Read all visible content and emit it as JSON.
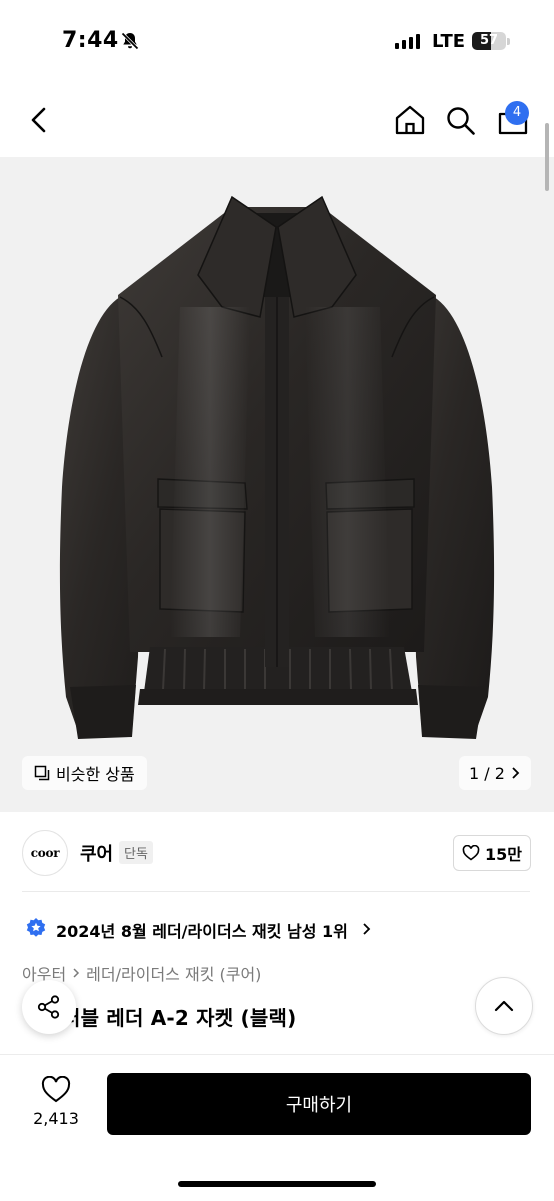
{
  "status_bar": {
    "time": "7:44",
    "network": "LTE",
    "battery_level": 57
  },
  "header": {
    "cart_count": "4"
  },
  "gallery": {
    "similar_label": "비슷한 상품",
    "pager": "1 / 2",
    "background": "#f1f1f1"
  },
  "brand": {
    "logo_text": "coor",
    "name": "쿠어",
    "exclusive_label": "단독",
    "like_count": "15만"
  },
  "ranking": {
    "text": "2024년 8월 레더/라이더스 재킷 남성 1위"
  },
  "breadcrumb": {
    "category": "아우터",
    "subcategory": "레더/라이더스 재킷 (쿠어)"
  },
  "product": {
    "title": "러블 레더 A-2 자켓 (블랙)"
  },
  "bottom": {
    "wish_count": "2,413",
    "buy_label": "구매하기"
  },
  "colors": {
    "accent": "#2f6ff0",
    "buy_button": "#000000"
  }
}
